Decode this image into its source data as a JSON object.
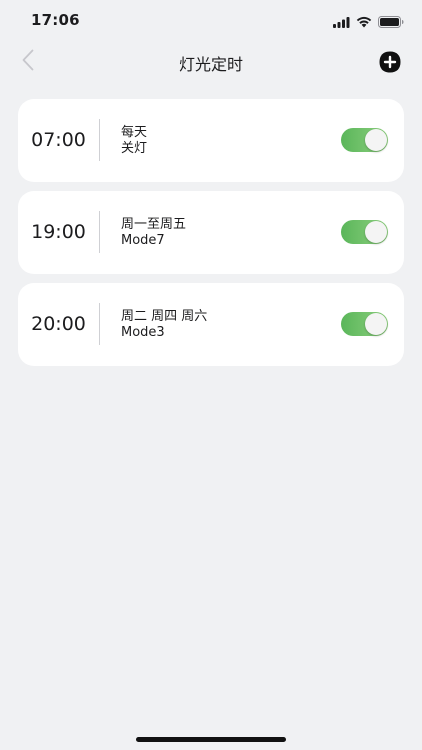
{
  "status_bar": {
    "time": "17:06",
    "icons": [
      "cellular-signal-icon",
      "wifi-icon",
      "battery-icon"
    ]
  },
  "nav": {
    "title": "灯光定时",
    "back_icon": "chevron-left-icon",
    "add_icon": "plus-circle-icon"
  },
  "timers": [
    {
      "time": "07:00",
      "days": "每天",
      "action": "关灯",
      "enabled": true
    },
    {
      "time": "19:00",
      "days": "周一至周五",
      "action": "Mode7",
      "enabled": true
    },
    {
      "time": "20:00",
      "days": "周二 周四 周六",
      "action": "Mode3",
      "enabled": true
    }
  ],
  "colors": {
    "background": "#f0f1f3",
    "card": "#ffffff",
    "toggle_on_start": "#5ab65a",
    "toggle_on_end": "#8ed07f",
    "back_icon": "#c7c7cc"
  }
}
